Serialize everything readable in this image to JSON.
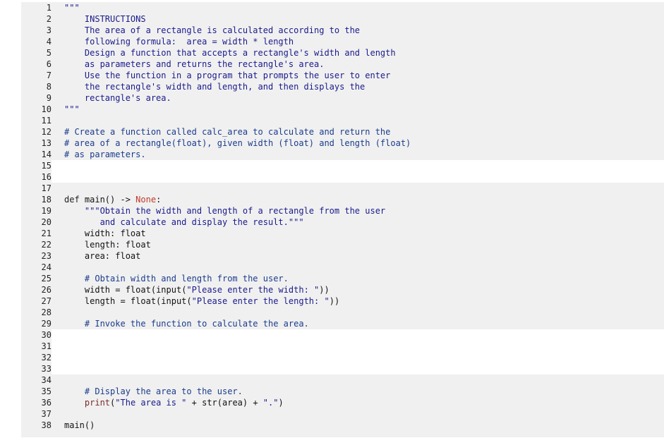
{
  "editor": {
    "lines": [
      {
        "n": "1",
        "tokens": [
          {
            "t": "\"\"\"",
            "c": "str"
          }
        ]
      },
      {
        "n": "2",
        "tokens": [
          {
            "t": "    INSTRUCTIONS",
            "c": "str"
          }
        ]
      },
      {
        "n": "3",
        "tokens": [
          {
            "t": "    The area of a rectangle is calculated according to the",
            "c": "str"
          }
        ]
      },
      {
        "n": "4",
        "tokens": [
          {
            "t": "    following formula:  area = width * length",
            "c": "str"
          }
        ]
      },
      {
        "n": "5",
        "tokens": [
          {
            "t": "    Design a function that accepts a rectangle's width and length",
            "c": "str"
          }
        ]
      },
      {
        "n": "6",
        "tokens": [
          {
            "t": "    as parameters and returns the rectangle's area.",
            "c": "str"
          }
        ]
      },
      {
        "n": "7",
        "tokens": [
          {
            "t": "    Use the function in a program that prompts the user to enter",
            "c": "str"
          }
        ]
      },
      {
        "n": "8",
        "tokens": [
          {
            "t": "    the rectangle's width and length, and then displays the",
            "c": "str"
          }
        ]
      },
      {
        "n": "9",
        "tokens": [
          {
            "t": "    rectangle's area.",
            "c": "str"
          }
        ]
      },
      {
        "n": "10",
        "tokens": [
          {
            "t": "\"\"\"",
            "c": "str"
          }
        ]
      },
      {
        "n": "11",
        "tokens": []
      },
      {
        "n": "12",
        "tokens": [
          {
            "t": "# Create a function called calc_area to calculate and return the",
            "c": "comment"
          }
        ]
      },
      {
        "n": "13",
        "tokens": [
          {
            "t": "# area of a rectangle(float), given width (float) and length (float)",
            "c": "comment"
          }
        ]
      },
      {
        "n": "14",
        "tokens": [
          {
            "t": "# as parameters.",
            "c": "comment"
          }
        ]
      },
      {
        "n": "15",
        "tokens": [],
        "editable": true
      },
      {
        "n": "16",
        "tokens": [],
        "editable": true
      },
      {
        "n": "17",
        "tokens": []
      },
      {
        "n": "18",
        "tokens": [
          {
            "t": "def ",
            "c": "kw"
          },
          {
            "t": "main() -> ",
            "c": "plain"
          },
          {
            "t": "None",
            "c": "const"
          },
          {
            "t": ":",
            "c": "plain"
          }
        ]
      },
      {
        "n": "19",
        "tokens": [
          {
            "t": "    \"\"\"Obtain the width and length of a rectangle from the user",
            "c": "str"
          }
        ]
      },
      {
        "n": "20",
        "tokens": [
          {
            "t": "       and calculate and display the result.\"\"\"",
            "c": "str"
          }
        ]
      },
      {
        "n": "21",
        "tokens": [
          {
            "t": "    width: ",
            "c": "plain"
          },
          {
            "t": "float",
            "c": "plain"
          }
        ]
      },
      {
        "n": "22",
        "tokens": [
          {
            "t": "    length: ",
            "c": "plain"
          },
          {
            "t": "float",
            "c": "plain"
          }
        ]
      },
      {
        "n": "23",
        "tokens": [
          {
            "t": "    area: ",
            "c": "plain"
          },
          {
            "t": "float",
            "c": "plain"
          }
        ]
      },
      {
        "n": "24",
        "tokens": []
      },
      {
        "n": "25",
        "tokens": [
          {
            "t": "    # Obtain width and length from the user.",
            "c": "comment"
          }
        ]
      },
      {
        "n": "26",
        "tokens": [
          {
            "t": "    width = ",
            "c": "plain"
          },
          {
            "t": "float",
            "c": "plain"
          },
          {
            "t": "(",
            "c": "plain"
          },
          {
            "t": "input",
            "c": "plain"
          },
          {
            "t": "(",
            "c": "plain"
          },
          {
            "t": "\"Please enter the width: \"",
            "c": "str"
          },
          {
            "t": "))",
            "c": "plain"
          }
        ]
      },
      {
        "n": "27",
        "tokens": [
          {
            "t": "    length = ",
            "c": "plain"
          },
          {
            "t": "float",
            "c": "plain"
          },
          {
            "t": "(",
            "c": "plain"
          },
          {
            "t": "input",
            "c": "plain"
          },
          {
            "t": "(",
            "c": "plain"
          },
          {
            "t": "\"Please enter the length: \"",
            "c": "str"
          },
          {
            "t": "))",
            "c": "plain"
          }
        ]
      },
      {
        "n": "28",
        "tokens": []
      },
      {
        "n": "29",
        "tokens": [
          {
            "t": "    # Invoke the function to calculate the area.",
            "c": "comment"
          }
        ]
      },
      {
        "n": "30",
        "tokens": [],
        "editable": true
      },
      {
        "n": "31",
        "tokens": [],
        "editable": true
      },
      {
        "n": "32",
        "tokens": [],
        "editable": true
      },
      {
        "n": "33",
        "tokens": [],
        "editable": true
      },
      {
        "n": "34",
        "tokens": []
      },
      {
        "n": "35",
        "tokens": [
          {
            "t": "    # Display the area to the user.",
            "c": "comment"
          }
        ]
      },
      {
        "n": "36",
        "tokens": [
          {
            "t": "    ",
            "c": "plain"
          },
          {
            "t": "print",
            "c": "builtin"
          },
          {
            "t": "(",
            "c": "plain"
          },
          {
            "t": "\"The area is \"",
            "c": "str"
          },
          {
            "t": " + str(area) + ",
            "c": "plain"
          },
          {
            "t": "\".\"",
            "c": "str"
          },
          {
            "t": ")",
            "c": "plain"
          }
        ]
      },
      {
        "n": "37",
        "tokens": []
      },
      {
        "n": "38",
        "tokens": [
          {
            "t": "main()",
            "c": "plain"
          }
        ]
      }
    ]
  },
  "colors": {
    "editor_bg": "#f0f0f0",
    "editable_bg": "#ffffff",
    "string": "#1a1a8c",
    "comment": "#1a3c8c",
    "constant": "#c0392b"
  }
}
